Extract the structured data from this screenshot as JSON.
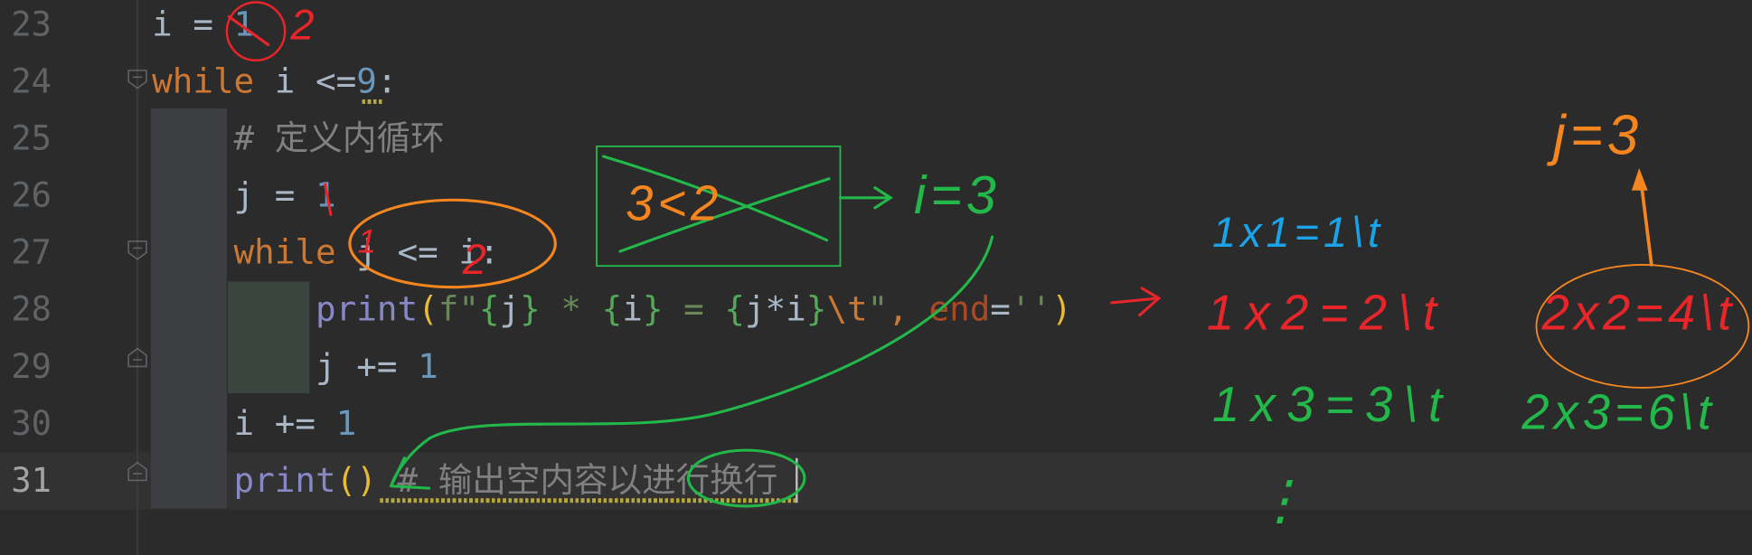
{
  "editor": {
    "current_line": 31,
    "lines": [
      {
        "number": "23",
        "tokens": [
          {
            "t": "i = ",
            "c": "id"
          },
          {
            "t": "1",
            "c": "num"
          }
        ]
      },
      {
        "number": "24",
        "tokens": [
          {
            "t": "while",
            "c": "kw"
          },
          {
            "t": " i <=",
            "c": "id"
          },
          {
            "t": "9",
            "c": "num"
          },
          {
            "t": ":",
            "c": "id"
          }
        ]
      },
      {
        "number": "25",
        "tokens": [
          {
            "t": "    # 定义内循环",
            "c": "cm"
          }
        ]
      },
      {
        "number": "26",
        "tokens": [
          {
            "t": "    j = ",
            "c": "id"
          },
          {
            "t": "1",
            "c": "num"
          }
        ]
      },
      {
        "number": "27",
        "tokens": [
          {
            "t": "    ",
            "c": "id"
          },
          {
            "t": "while",
            "c": "kw"
          },
          {
            "t": " j <= i:",
            "c": "id"
          }
        ]
      },
      {
        "number": "28",
        "tokens": [
          {
            "t": "        ",
            "c": "id"
          },
          {
            "t": "print",
            "c": "fn"
          },
          {
            "t": "(",
            "c": "par"
          },
          {
            "t": "f\"",
            "c": "str"
          },
          {
            "t": "{",
            "c": "br"
          },
          {
            "t": "j",
            "c": "id"
          },
          {
            "t": "}",
            "c": "br"
          },
          {
            "t": " * ",
            "c": "str"
          },
          {
            "t": "{",
            "c": "br"
          },
          {
            "t": "i",
            "c": "id"
          },
          {
            "t": "}",
            "c": "br"
          },
          {
            "t": " = ",
            "c": "str"
          },
          {
            "t": "{",
            "c": "br"
          },
          {
            "t": "j*i",
            "c": "id"
          },
          {
            "t": "}",
            "c": "br"
          },
          {
            "t": "\\t",
            "c": "esc"
          },
          {
            "t": "\"",
            "c": "str"
          },
          {
            "t": ", ",
            "c": "kw"
          },
          {
            "t": "end",
            "c": "arg"
          },
          {
            "t": "=",
            "c": "id"
          },
          {
            "t": "''",
            "c": "str"
          },
          {
            "t": ")",
            "c": "par"
          }
        ]
      },
      {
        "number": "29",
        "tokens": [
          {
            "t": "        j += ",
            "c": "id"
          },
          {
            "t": "1",
            "c": "num"
          }
        ]
      },
      {
        "number": "30",
        "tokens": [
          {
            "t": "    i += ",
            "c": "id"
          },
          {
            "t": "1",
            "c": "num"
          }
        ]
      },
      {
        "number": "31",
        "tokens": [
          {
            "t": "    ",
            "c": "id"
          },
          {
            "t": "print",
            "c": "fn"
          },
          {
            "t": "()",
            "c": "par"
          },
          {
            "t": " # 输出空内容以进行换行",
            "c": "cm"
          }
        ]
      }
    ]
  },
  "annotations": {
    "i_value": "2",
    "j_line26_mark": "1",
    "j_line27_mark": "1",
    "i_line27_mark": "2",
    "boxed_condition": "3<2",
    "i_equals": "i=3",
    "row1": "1x1=1\\t",
    "row2a": "1x2=2\\t",
    "row2b": "2x2=4\\t",
    "row3a": "1x3=3\\t",
    "row3b": "2x3=6\\t",
    "j_equals": "j=3",
    "ellipsis": "⋮",
    "colors": {
      "red": "#e8262a",
      "orange": "#f5861f",
      "green": "#22b84a",
      "blue": "#1aa3e8"
    }
  }
}
